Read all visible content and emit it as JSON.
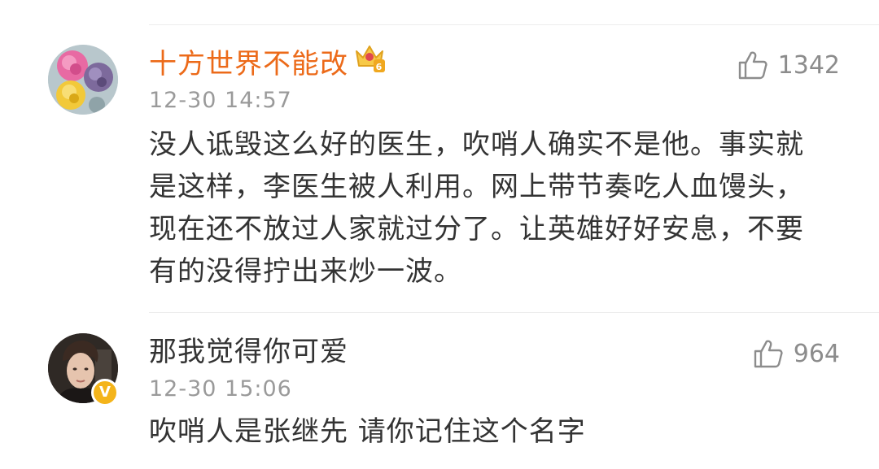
{
  "comments": [
    {
      "username": "十方世界不能改",
      "timestamp": "12-30 14:57",
      "text": "没人诋毁这么好的医生，吹哨人确实不是他。事实就是这样，李医生被人利用。网上带节奏吃人血馒头，现在还不放过人家就过分了。让英雄好好安息，不要有的没得拧出来炒一波。",
      "likes": "1342",
      "badge": "crown-vip-level-6",
      "badge_level": "6",
      "accent_color": "#ec6a19"
    },
    {
      "username": "那我觉得你可爱",
      "timestamp": "12-30 15:06",
      "text": "吹哨人是张继先 请你记住这个名字",
      "likes": "964",
      "badge": "verified-v-icon",
      "badge_letter": "V"
    }
  ]
}
